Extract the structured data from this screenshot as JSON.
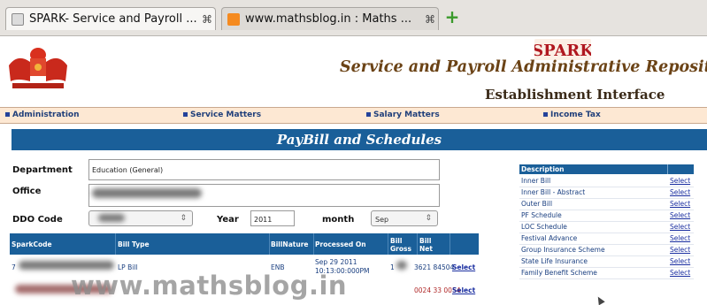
{
  "browser": {
    "tabs": [
      {
        "title": "SPARK- Service and Payroll ...",
        "favicon": "page-icon",
        "close": "⌘",
        "active": true
      },
      {
        "title": "www.mathsblog.in : Maths ...",
        "favicon": "blogger-icon",
        "close": "⌘",
        "active": false
      }
    ],
    "new_tab_icon": "plus-icon",
    "new_tab_glyph": "+"
  },
  "header": {
    "logo_text": "SPARK",
    "title": "Service and Payroll Administrative Repository",
    "subtitle": "Establishment Interface",
    "emblem": "kerala-emblem-icon"
  },
  "menu": [
    "Administration",
    "Service Matters",
    "Salary Matters",
    "Income Tax"
  ],
  "page": {
    "banner": "PayBill and Schedules"
  },
  "form": {
    "department_label": "Department",
    "department_value": "Education (General)",
    "office_label": "Office",
    "office_value": "",
    "ddo_label": "DDO Code",
    "year_label": "Year",
    "year_value": "2011",
    "month_label": "month",
    "month_value": "Sep",
    "select_arrow": "⇕"
  },
  "bills_table": {
    "headers": [
      "SparkCode",
      "Bill Type",
      "BillNature",
      "Processed On",
      "Bill Gross",
      "Bill Net",
      ""
    ],
    "rows": [
      {
        "spark_code": "7",
        "bill_type": "LP Bill",
        "bill_nature": "ENB",
        "processed_on": "Sep 29 2011 10:13:00:000PM",
        "bill_gross": "1",
        "bill_net": "3621 84504",
        "action": "Select"
      },
      {
        "spark_code": "",
        "bill_type": "",
        "bill_nature": "",
        "processed_on": "",
        "bill_gross": "",
        "bill_net": "0024 33 0054",
        "action": "Select"
      }
    ]
  },
  "description_table": {
    "header": "Description",
    "rows": [
      {
        "name": "Inner Bill",
        "action": "Select"
      },
      {
        "name": "Inner Bill - Abstract",
        "action": "Select"
      },
      {
        "name": "Outer Bill",
        "action": "Select"
      },
      {
        "name": "PF Schedule",
        "action": "Select"
      },
      {
        "name": "LOC Schedule",
        "action": "Select"
      },
      {
        "name": "Festival Advance",
        "action": "Select"
      },
      {
        "name": "Group Insurance Scheme",
        "action": "Select"
      },
      {
        "name": "State Life Insurance",
        "action": "Select"
      },
      {
        "name": "Family Benefit Scheme",
        "action": "Select"
      }
    ]
  },
  "watermark": "www.mathsblog.in",
  "colors": {
    "banner": "#1a5f99",
    "menu_bg": "#fde8d3",
    "title": "#6b4316",
    "link": "#1a2ea0"
  }
}
